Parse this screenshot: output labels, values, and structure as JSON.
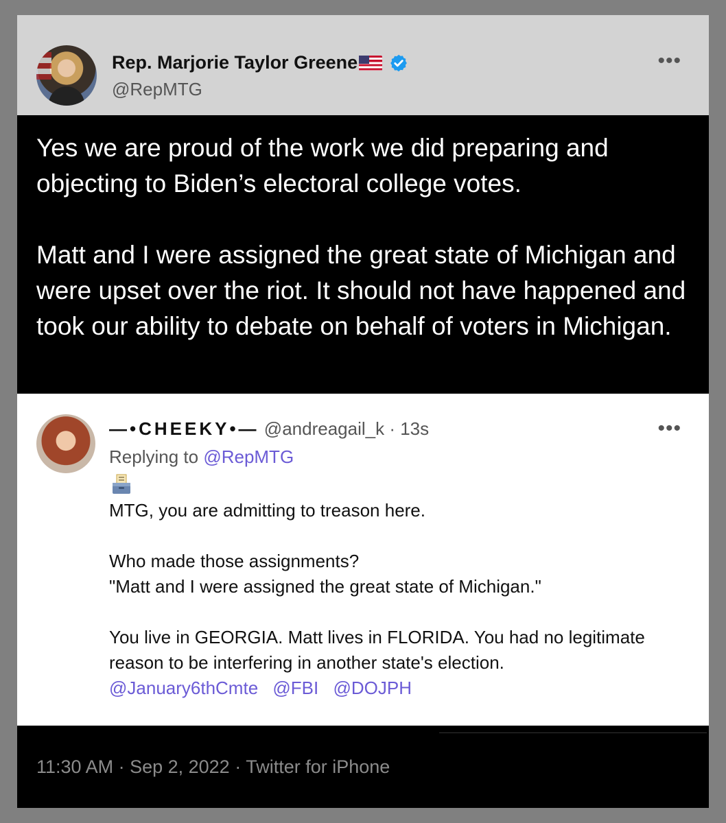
{
  "tweet": {
    "author_name": "Rep. Marjorie Taylor Greene",
    "author_handle": "@RepMTG",
    "paragraphs": [
      "Yes we are proud of the work we did preparing and objecting to Biden’s electoral college votes.",
      "Matt and I were assigned the great state of Michigan and were upset over the riot. It should not have happened and took our ability to debate on behalf of voters in Michigan."
    ],
    "more_label": "•••",
    "footer": "11:30 AM · Sep 2, 2022 · Twitter for iPhone"
  },
  "reply": {
    "author_name": "—•CHEEKY•—",
    "author_handle": "@andreagail_k",
    "time": "· 13s",
    "replying_prefix": "Replying to",
    "replying_handle": "@RepMTG",
    "more_label": "•••",
    "line1": "MTG, you are admitting to treason here.",
    "line2": "Who made those assignments?",
    "line3": "\"Matt and I were assigned the great state of Michigan.\"",
    "line4": "You live in GEORGIA. Matt lives in FLORIDA. You had no legitimate reason to be interfering in another state's election.",
    "mentions": [
      "@January6thCmte",
      "@FBI",
      "@DOJPH"
    ]
  },
  "colors": {
    "link": "#6b5bd6",
    "verified": "#1d9bf0",
    "header_bg": "#d3d3d3"
  },
  "icons": [
    "verified-badge-icon",
    "us-flag-icon",
    "ballot-box-icon",
    "more-icon"
  ]
}
